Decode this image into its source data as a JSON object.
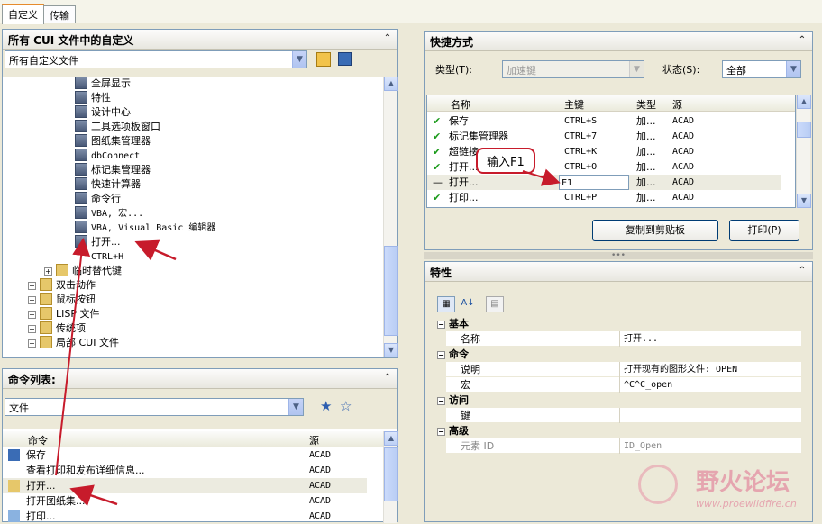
{
  "tabs": [
    "自定义",
    "传输"
  ],
  "left_top": {
    "title": "所有 CUI 文件中的自定义",
    "filter_value": "所有自定义文件",
    "tree_items": [
      {
        "label": "全屏显示",
        "type": "cmd"
      },
      {
        "label": "特性",
        "type": "cmd"
      },
      {
        "label": "设计中心",
        "type": "cmd"
      },
      {
        "label": "工具选项板窗口",
        "type": "cmd"
      },
      {
        "label": "图纸集管理器",
        "type": "cmd"
      },
      {
        "label": "dbConnect",
        "type": "cmd"
      },
      {
        "label": "标记集管理器",
        "type": "cmd"
      },
      {
        "label": "快速计算器",
        "type": "cmd"
      },
      {
        "label": "命令行",
        "type": "cmd"
      },
      {
        "label": "VBA, 宏...",
        "type": "cmd"
      },
      {
        "label": "VBA, Visual Basic 编辑器",
        "type": "cmd"
      },
      {
        "label": "打开...",
        "type": "cmd"
      },
      {
        "label": "CTRL+H",
        "type": "none"
      }
    ],
    "tree_nodes": [
      {
        "label": "临时替代键",
        "indent": 1
      },
      {
        "label": "双击动作",
        "indent": 0
      },
      {
        "label": "鼠标按钮",
        "indent": 0
      },
      {
        "label": "LISP 文件",
        "indent": 0
      },
      {
        "label": "传统项",
        "indent": 0
      },
      {
        "label": "局部 CUI 文件",
        "indent": 0
      }
    ]
  },
  "left_bottom": {
    "title": "命令列表:",
    "category_value": "文件",
    "col_command": "命令",
    "col_source": "源",
    "rows": [
      {
        "name": "保存",
        "source": "ACAD"
      },
      {
        "name": "查看打印和发布详细信息...",
        "source": "ACAD"
      },
      {
        "name": "打开...",
        "source": "ACAD"
      },
      {
        "name": "打开图纸集...",
        "source": "ACAD"
      },
      {
        "name": "打印...",
        "source": "ACAD"
      }
    ]
  },
  "shortcuts": {
    "title": "快捷方式",
    "type_label": "类型(T):",
    "type_value": "加速键",
    "status_label": "状态(S):",
    "status_value": "全部",
    "col_name": "名称",
    "col_key": "主键",
    "col_type": "类型",
    "col_source": "源",
    "rows": [
      {
        "name": "保存",
        "key": "CTRL+S",
        "type": "加...",
        "source": "ACAD"
      },
      {
        "name": "标记集管理器",
        "key": "CTRL+7",
        "type": "加...",
        "source": "ACAD"
      },
      {
        "name": "超链接",
        "key": "CTRL+K",
        "type": "加...",
        "source": "ACAD"
      },
      {
        "name": "打开...",
        "key": "CTRL+O",
        "type": "加...",
        "source": "ACAD"
      },
      {
        "name": "打开...",
        "key": "F1",
        "type": "加...",
        "source": "ACAD"
      },
      {
        "name": "打印...",
        "key": "CTRL+P",
        "type": "加...",
        "source": "ACAD"
      }
    ],
    "copy_button": "复制到剪贴板",
    "print_button": "打印(P)"
  },
  "callout": "输入F1",
  "properties": {
    "title": "特性",
    "categories": [
      {
        "name": "基本",
        "rows": [
          {
            "k": "名称",
            "v": "打开..."
          }
        ]
      },
      {
        "name": "命令",
        "rows": [
          {
            "k": "说明",
            "v": "打开现有的图形文件:  OPEN"
          },
          {
            "k": "宏",
            "v": "^C^C_open"
          }
        ]
      },
      {
        "name": "访问",
        "rows": [
          {
            "k": "键",
            "v": ""
          }
        ]
      },
      {
        "name": "高级",
        "rows": [
          {
            "k": "元素 ID",
            "v": "ID_Open"
          }
        ]
      }
    ]
  },
  "watermark": {
    "name": "野火论坛",
    "url": "www.proewildfire.cn"
  },
  "colors": {
    "arrow": "#c71b2b",
    "check": "#1a9a1a",
    "accent": "#e68b2c"
  }
}
